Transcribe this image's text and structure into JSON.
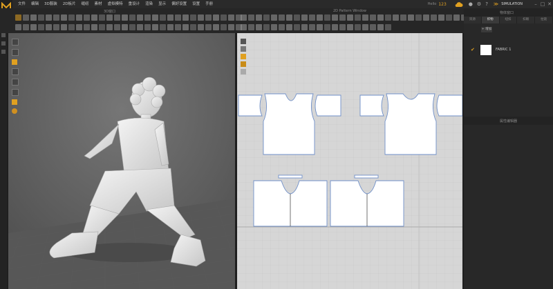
{
  "menu": {
    "items": [
      "文件",
      "编辑",
      "3D服装",
      "2D板片",
      "缝纫",
      "素材",
      "虚拟模特",
      "重设计",
      "渲染",
      "显示",
      "偏好设置",
      "设置",
      "手册"
    ]
  },
  "header": {
    "version_tag": "Hello",
    "count": "123",
    "simulation": "SIMULATION"
  },
  "viewport3d": {
    "title": "3D窗口"
  },
  "viewport2d": {
    "title": "2D Pattern Window"
  },
  "right_panel": {
    "title": "物体窗口",
    "tabs": [
      "资源",
      "织物",
      "纽扣",
      "扣眼",
      "拉链"
    ],
    "active_tab": 1,
    "add_button": "+ 增加",
    "fabric_name": "FABRIC 1",
    "section2_title": "属性编辑器"
  },
  "colors": {
    "accent": "#e0a020",
    "pattern_outline": "#6f8fc8",
    "viewport_bg": "#5f5f5f",
    "pattern_bg": "#d6d6d6"
  }
}
